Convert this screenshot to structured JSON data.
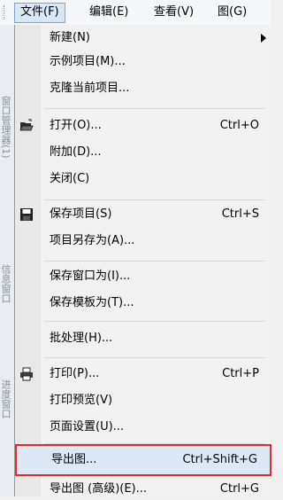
{
  "menubar": {
    "items": [
      {
        "label": "文件(F)"
      },
      {
        "label": "编辑(E)"
      },
      {
        "label": "查看(V)"
      },
      {
        "label": "图(G)"
      }
    ]
  },
  "left_tabs": [
    {
      "label": "窗口管理器(1)"
    },
    {
      "label": "信息窗口"
    },
    {
      "label": "进度窗口"
    }
  ],
  "file_menu": {
    "items": [
      {
        "label": "新建(N)",
        "shortcut": "",
        "submenu": true
      },
      {
        "label": "示例项目(M)...",
        "shortcut": ""
      },
      {
        "label": "克隆当前项目...",
        "shortcut": ""
      },
      {
        "label": "打开(O)...",
        "shortcut": "Ctrl+O",
        "icon": "open-folder-icon"
      },
      {
        "label": "附加(D)...",
        "shortcut": ""
      },
      {
        "label": "关闭(C)",
        "shortcut": ""
      },
      {
        "label": "保存项目(S)",
        "shortcut": "Ctrl+S",
        "icon": "save-disk-icon"
      },
      {
        "label": "项目另存为(A)...",
        "shortcut": ""
      },
      {
        "label": "保存窗口为(I)...",
        "shortcut": ""
      },
      {
        "label": "保存模板为(T)...",
        "shortcut": ""
      },
      {
        "label": "批处理(H)...",
        "shortcut": ""
      },
      {
        "label": "打印(P)...",
        "shortcut": "Ctrl+P",
        "icon": "printer-icon"
      },
      {
        "label": "打印预览(V)",
        "shortcut": ""
      },
      {
        "label": "页面设置(U)...",
        "shortcut": ""
      },
      {
        "label": "导出图...",
        "shortcut": "Ctrl+Shift+G",
        "highlighted": true
      },
      {
        "label": "导出图 (高级)(E)...",
        "shortcut": "Ctrl+G"
      }
    ]
  }
}
